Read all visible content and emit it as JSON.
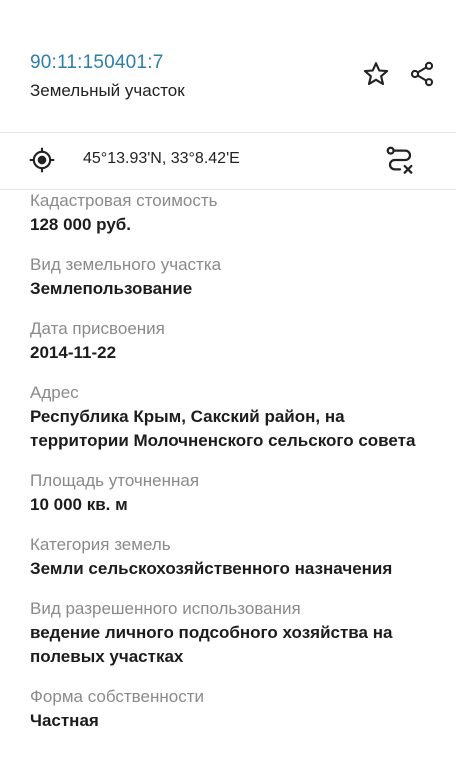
{
  "header": {
    "cadastral_number": "90:11:150401:7",
    "object_type": "Земельный участок"
  },
  "coordinates": {
    "text": "45°13.93'N, 33°8.42'E"
  },
  "fields": [
    {
      "label": "Кадастровая стоимость",
      "value": "128 000 руб."
    },
    {
      "label": "Вид земельного участка",
      "value": "Землепользование"
    },
    {
      "label": "Дата присвоения",
      "value": "2014-11-22"
    },
    {
      "label": "Адрес",
      "value": "Республика Крым, Сакский район, на территории Молочненского сельского совета"
    },
    {
      "label": "Площадь уточненная",
      "value": "10 000 кв. м"
    },
    {
      "label": "Категория земель",
      "value": "Земли сельскохозяйственного назначения"
    },
    {
      "label": "Вид разрешенного использования",
      "value": "ведение личного подсобного хозяйства на полевых участках"
    },
    {
      "label": "Форма собственности",
      "value": "Частная"
    }
  ],
  "colors": {
    "link": "#2d7fa8",
    "label": "#8a8a8a",
    "value": "#1c1c1c"
  },
  "icons": [
    "star-icon",
    "share-icon",
    "target-icon",
    "route-clear-icon"
  ]
}
